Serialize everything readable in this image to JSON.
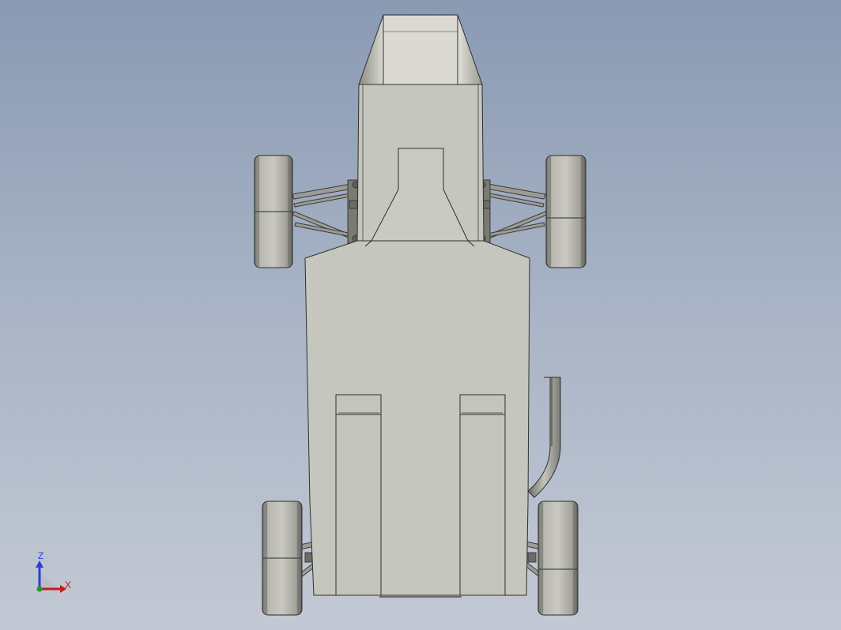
{
  "viewport": {
    "background_top": "#8a9ab3",
    "background_bottom": "#c3c9d4",
    "model": {
      "body_color": "#c5c6bd",
      "edge_color": "#2f2f2f",
      "tire_color": "#9e9e96"
    }
  },
  "triad": {
    "z_label": "Z",
    "x_label": "X",
    "z_color": "#2b3bd6",
    "x_color": "#c21b1b",
    "origin_color": "#1f9a2a"
  }
}
